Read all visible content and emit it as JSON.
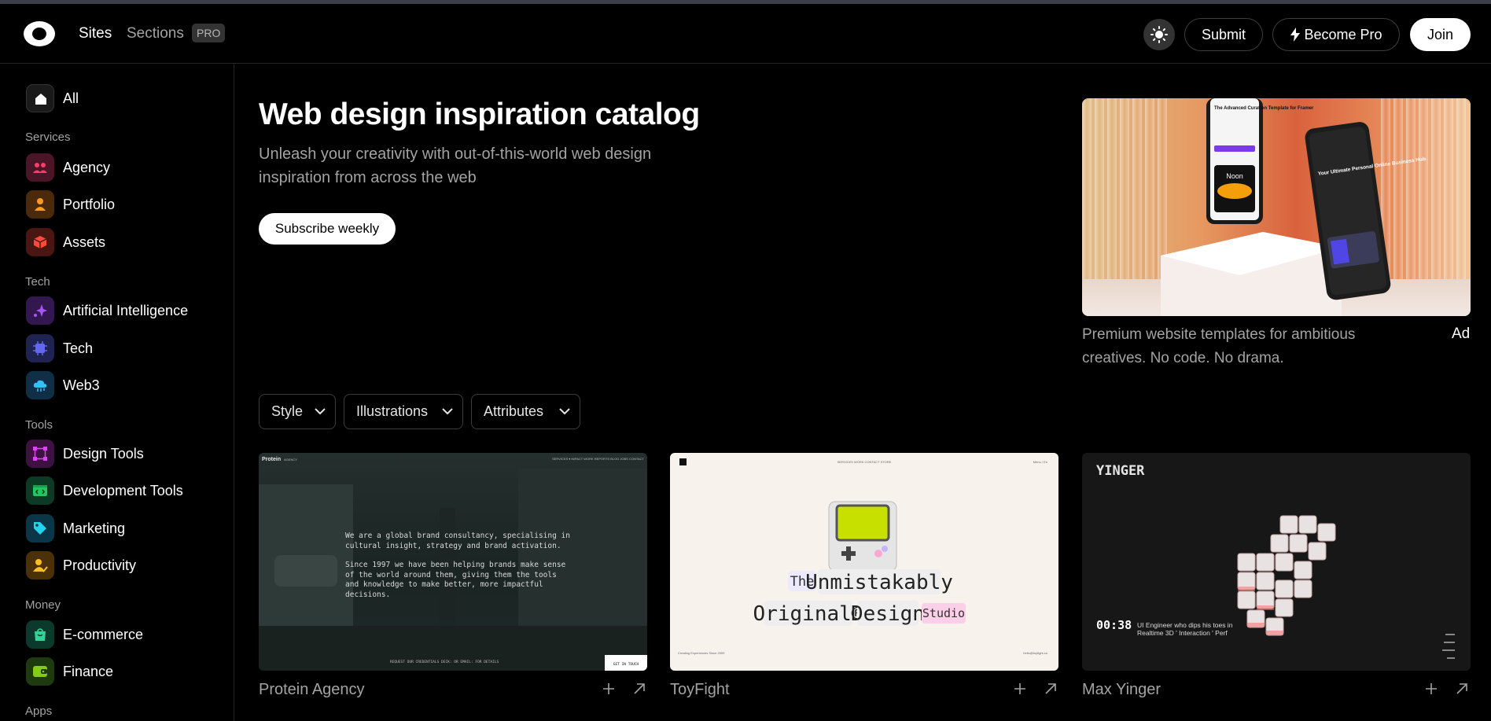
{
  "header": {
    "nav_sites": "Sites",
    "nav_sections": "Sections",
    "pro_badge": "PRO",
    "submit_label": "Submit",
    "become_pro_label": "Become Pro",
    "join_label": "Join"
  },
  "sidebar": {
    "all_label": "All",
    "groups": [
      {
        "heading": "Services",
        "items": [
          "Agency",
          "Portfolio",
          "Assets"
        ]
      },
      {
        "heading": "Tech",
        "items": [
          "Artificial Intelligence",
          "Tech",
          "Web3"
        ]
      },
      {
        "heading": "Tools",
        "items": [
          "Design Tools",
          "Development Tools",
          "Marketing",
          "Productivity"
        ]
      },
      {
        "heading": "Money",
        "items": [
          "E-commerce",
          "Finance"
        ]
      },
      {
        "heading": "Apps",
        "items": []
      }
    ]
  },
  "hero": {
    "title": "Web design inspiration catalog",
    "subtitle": "Unleash your creativity with out-of-this-world web design inspiration from across the web",
    "subscribe_label": "Subscribe weekly"
  },
  "ad": {
    "description": "Premium website templates for ambitious creatives. No code. No drama.",
    "tag": "Ad",
    "phone1_heading": "The Advanced Curation Template for Framer",
    "phone1_card": "Noon",
    "phone2_heading": "Your Ultimate Personal Online Business Hub."
  },
  "filters": {
    "style": "Style",
    "illustrations": "Illustrations",
    "attributes": "Attributes"
  },
  "cards": [
    {
      "title": "Protein Agency",
      "brand": "Protein",
      "brand_sub": "AGENCY",
      "nav": "SERVICES ▾   IMPACT   WORK   REPORTS   BLOG   JOBS   CONTACT",
      "para1": "We are a global brand consultancy, specialising in cultural insight, strategy and brand activation.",
      "para2": "Since 1997 we have been helping brands make sense of the world around them, giving them the tools and knowledge to make better, more impactful decisions.",
      "footer": "REQUEST OUR CREDENTIALS DECK: OR EMAIL: FOR DETAILS",
      "cta": "GET IN TOUCH"
    },
    {
      "title": "ToyFight",
      "nav": "SERVICES   WORK   CONTACT   STORE",
      "corner": "Menu / En",
      "word_the": "The",
      "word_unmistakably": "Unmistakably",
      "word_original": "Original®",
      "word_design": "Design",
      "word_studio": "Studio",
      "footer_left": "Creating Experiences Since 2009",
      "footer_right": "hello@toyfight.co"
    },
    {
      "title": "Max Yinger",
      "logo": "YINGER",
      "time": "00:38",
      "intro": "UI Engineer who dips his toes in Realtime 3D ' Interaction ' Perf"
    }
  ]
}
